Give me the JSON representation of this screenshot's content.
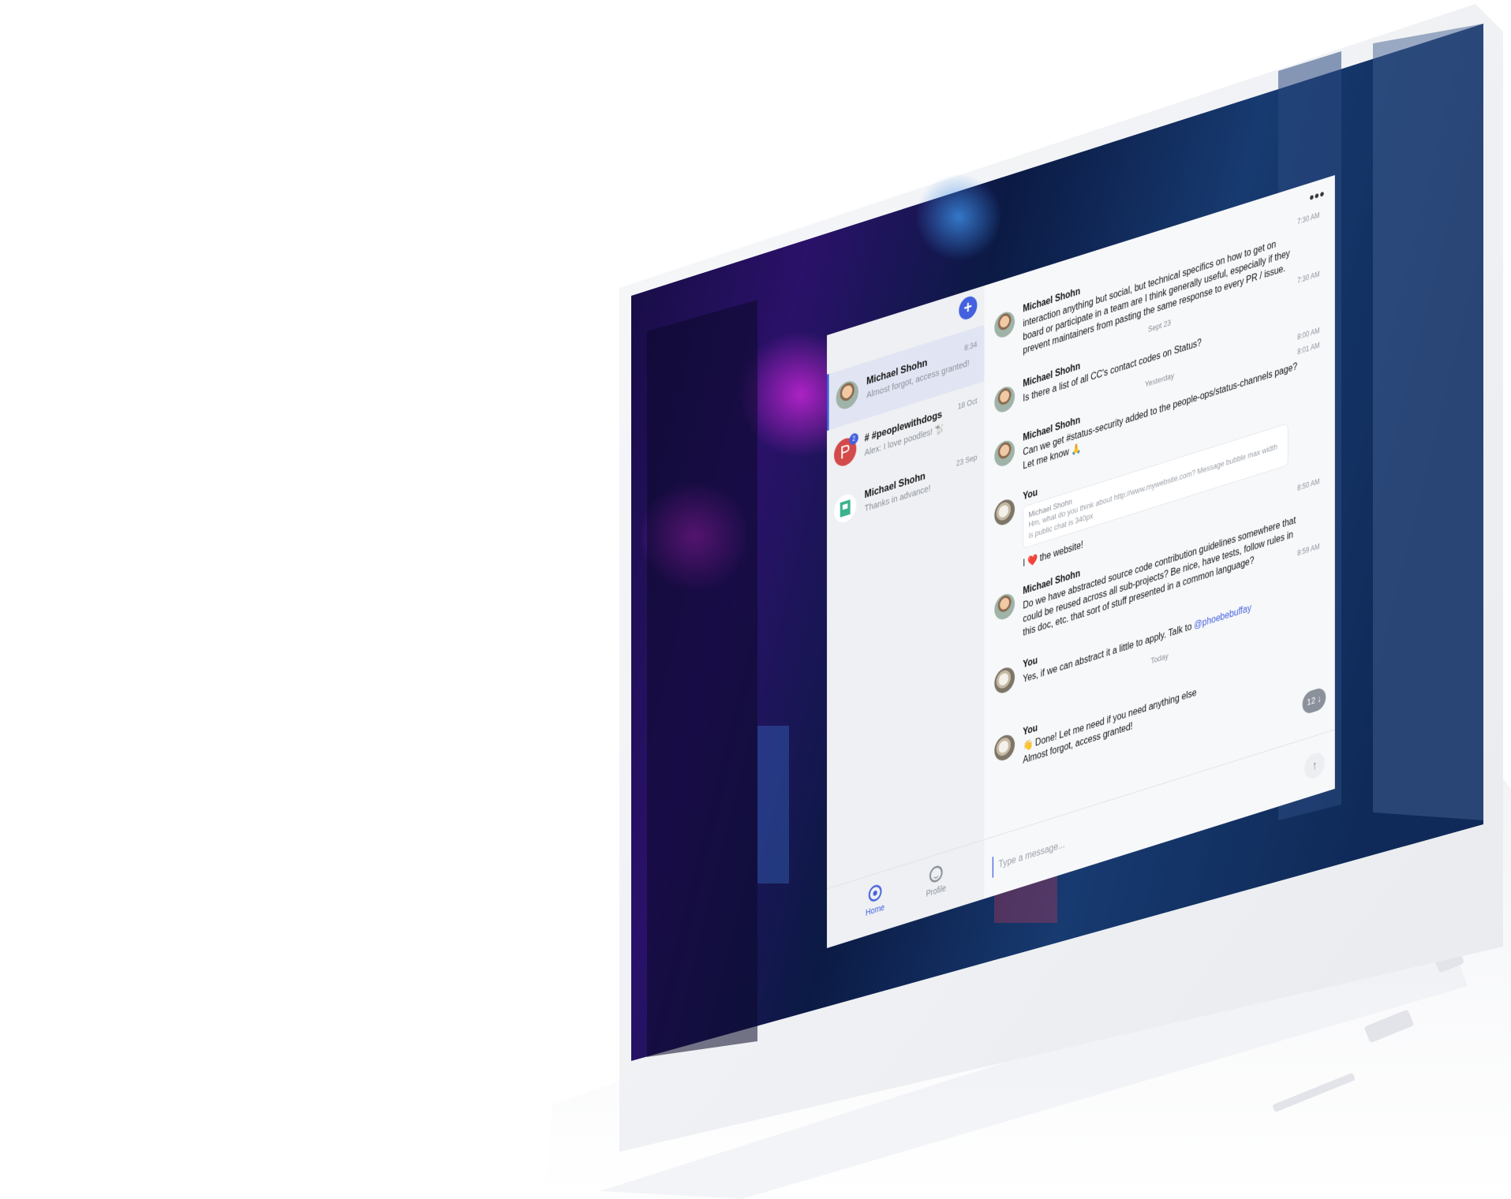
{
  "colors": {
    "accent": "#4360df",
    "unread": "#4360df",
    "letter_avatar": "#d34a4a",
    "identicon": "#39b28d",
    "muted_text": "#8a8f98"
  },
  "sidebar": {
    "new_chat_icon": "plus-icon",
    "new_chat_label": "+",
    "chats": [
      {
        "name": "Michael Shohn",
        "preview": "Almost forgot, access granted!",
        "time": "8:34",
        "avatar": "photo",
        "active": true
      },
      {
        "name": "# #peoplewithdogs",
        "preview": "Alex: I love poodles! 🐩",
        "time": "18 Oct",
        "avatar": "letter",
        "avatar_letter": "P",
        "unread": "2"
      },
      {
        "name": "Michael Shohn",
        "preview": "Thanks in advance!",
        "time": "23 Sep",
        "avatar": "identicon"
      }
    ],
    "bottom_nav": {
      "home_label": "Home",
      "profile_label": "Profile"
    }
  },
  "chat": {
    "more_label": "•••",
    "messages": [
      {
        "author": "Michael Shohn",
        "text": "interaction anything but social, but technical specifics on how to get on board or participate in a team are I think generally useful, especially if they prevent maintainers from pasting the same response to every PR / issue.",
        "time": "7:30 AM",
        "avatar": "photo"
      },
      {
        "author": "Michael Shohn",
        "text": "Is there a list of all CC's contact codes on Status?",
        "time": "7:30 AM",
        "avatar": "photo"
      },
      {
        "author": "Michael Shohn",
        "text": "Can we get #status-security added to the people-ops/status-channels page?",
        "time": "8:00 AM",
        "avatar": "photo"
      },
      {
        "author": "Michael Shohn",
        "text": "Let me know 🙏",
        "time": "8:01 AM",
        "avatar": "photo"
      },
      {
        "author": "You",
        "quote_author": "Michael Shohn",
        "quote_text": "Hm, what do you think about http://www.mywebsite.com? Message bubble max width is public chat is 340px",
        "text": "I ❤️ the website!",
        "time": "",
        "avatar": "you"
      },
      {
        "author": "Michael Shohn",
        "text": "Do we have abstracted source code contribution guidelines somewhere that could be reused across all sub-projects? Be nice, have tests, follow rules in this doc, etc. that sort of stuff presented in a common language?",
        "time": "8:50 AM",
        "avatar": "photo"
      },
      {
        "author": "You",
        "text": "Yes, if we can abstract it a little to apply. Talk to",
        "mention": "@phoebebuffay",
        "time": "8:59 AM",
        "avatar": "you"
      },
      {
        "author": "You",
        "text": "👋 Done! Let me need if you need anything else",
        "text2": "Almost forgot, access granted!",
        "time": "",
        "avatar": "you"
      }
    ],
    "dividers": {
      "d1": "Sept 23",
      "d2": "Yesterday",
      "d3": "Today"
    },
    "scroll_down_label": "12 ↓",
    "composer": {
      "placeholder": "Type a message...",
      "value": ""
    },
    "send_icon": "arrow-up-icon",
    "send_label": "↑"
  }
}
